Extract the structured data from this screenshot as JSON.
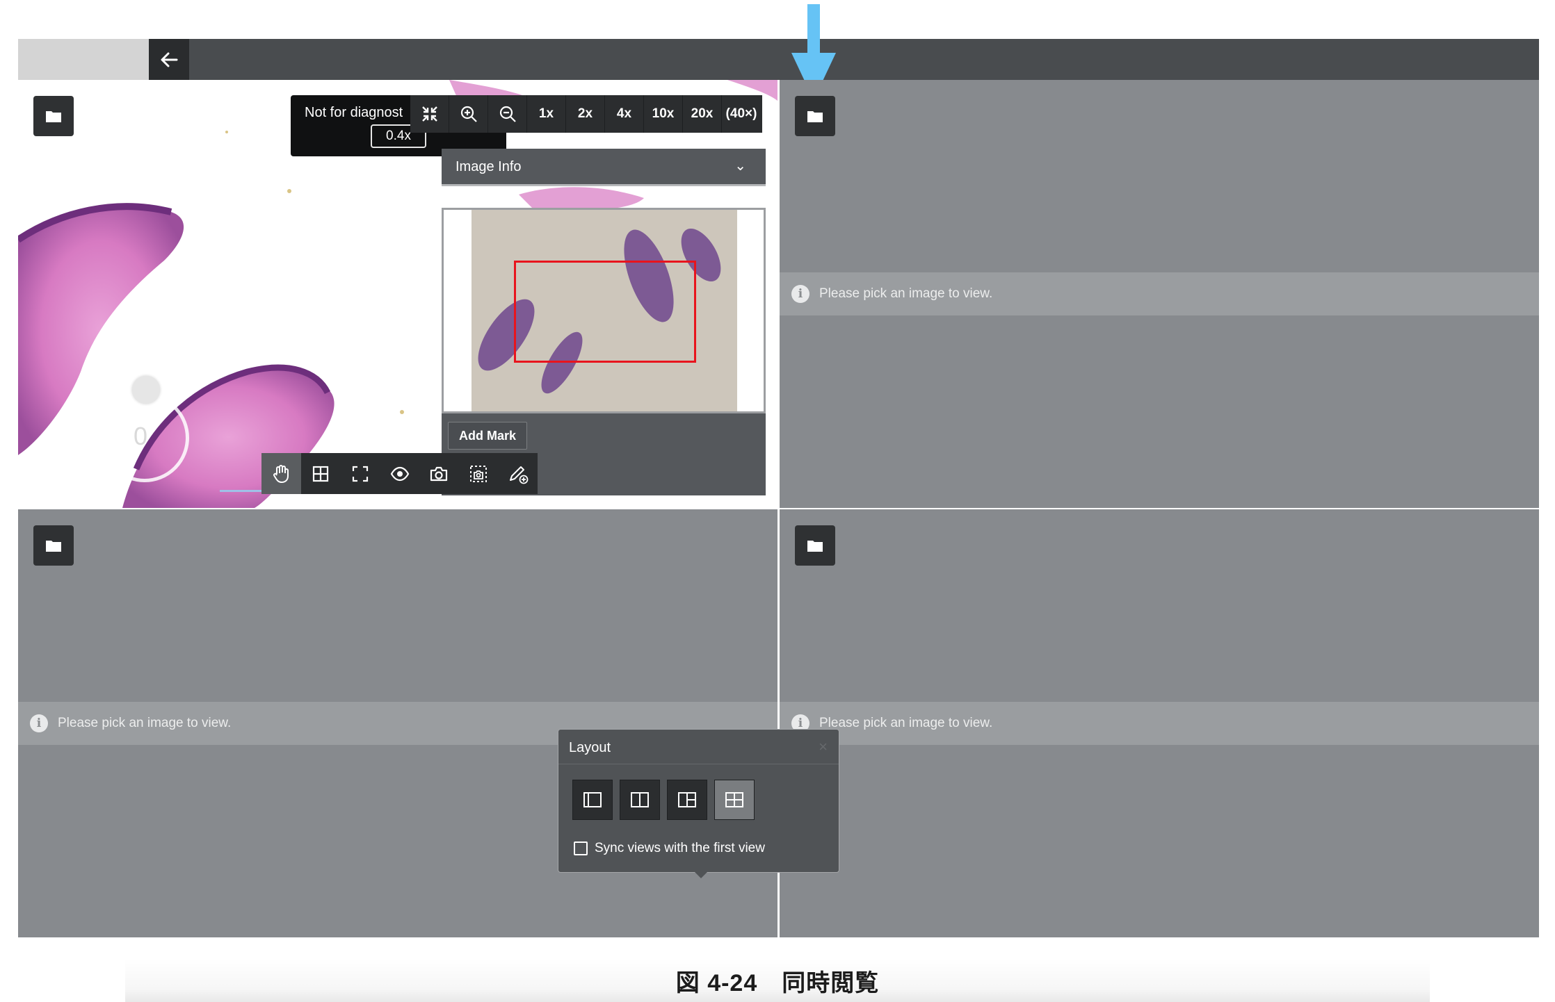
{
  "viewer": {
    "not_for_diagnosis": "Not for diagnost",
    "current_zoom": "0.4x",
    "zoom_levels": [
      "1x",
      "2x",
      "4x",
      "10x",
      "20x",
      "(40×)"
    ],
    "image_info_label": "Image Info",
    "add_mark_label": "Add Mark",
    "rotation_value": "0",
    "active_tool": "pan"
  },
  "empty_panel": {
    "message": "Please pick an image to view."
  },
  "layout_popup": {
    "title": "Layout",
    "close_symbol": "×",
    "sync_label": "Sync views with the first view",
    "sync_checked": false,
    "selected_layout": "2x2 grid"
  },
  "icons": {
    "back": "arrow-left-icon",
    "folder": "folder-icon",
    "info": "info-circle-icon"
  },
  "colors": {
    "toolbar_dark": "#2b2d2f",
    "panel_gray": "#878a8e",
    "roi_red": "#e8141d",
    "annotation_arrow": "#66c3f5"
  },
  "caption": {
    "text": "図 4-24　同時閲覧"
  }
}
